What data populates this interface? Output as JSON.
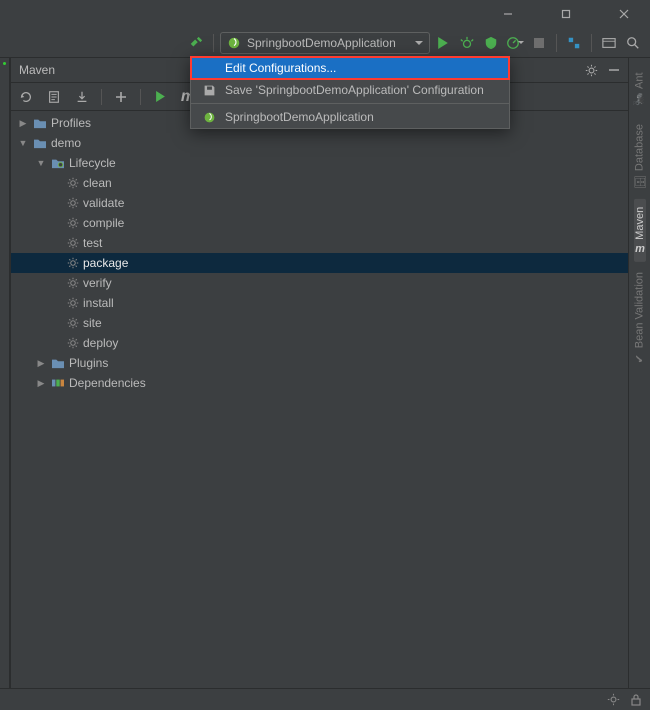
{
  "run_config": {
    "label": "SpringbootDemoApplication"
  },
  "dropdown": {
    "edit": "Edit Configurations...",
    "save": "Save 'SpringbootDemoApplication' Configuration",
    "app": "SpringbootDemoApplication"
  },
  "panel": {
    "title": "Maven"
  },
  "right_tabs": {
    "ant": "Ant",
    "database": "Database",
    "maven": "Maven",
    "bean": "Bean Validation"
  },
  "tree": {
    "profiles": "Profiles",
    "demo": "demo",
    "lifecycle_label": "Lifecycle",
    "lifecycle": [
      "clean",
      "validate",
      "compile",
      "test",
      "package",
      "verify",
      "install",
      "site",
      "deploy"
    ],
    "selected_lifecycle": "package",
    "plugins": "Plugins",
    "dependencies": "Dependencies"
  }
}
